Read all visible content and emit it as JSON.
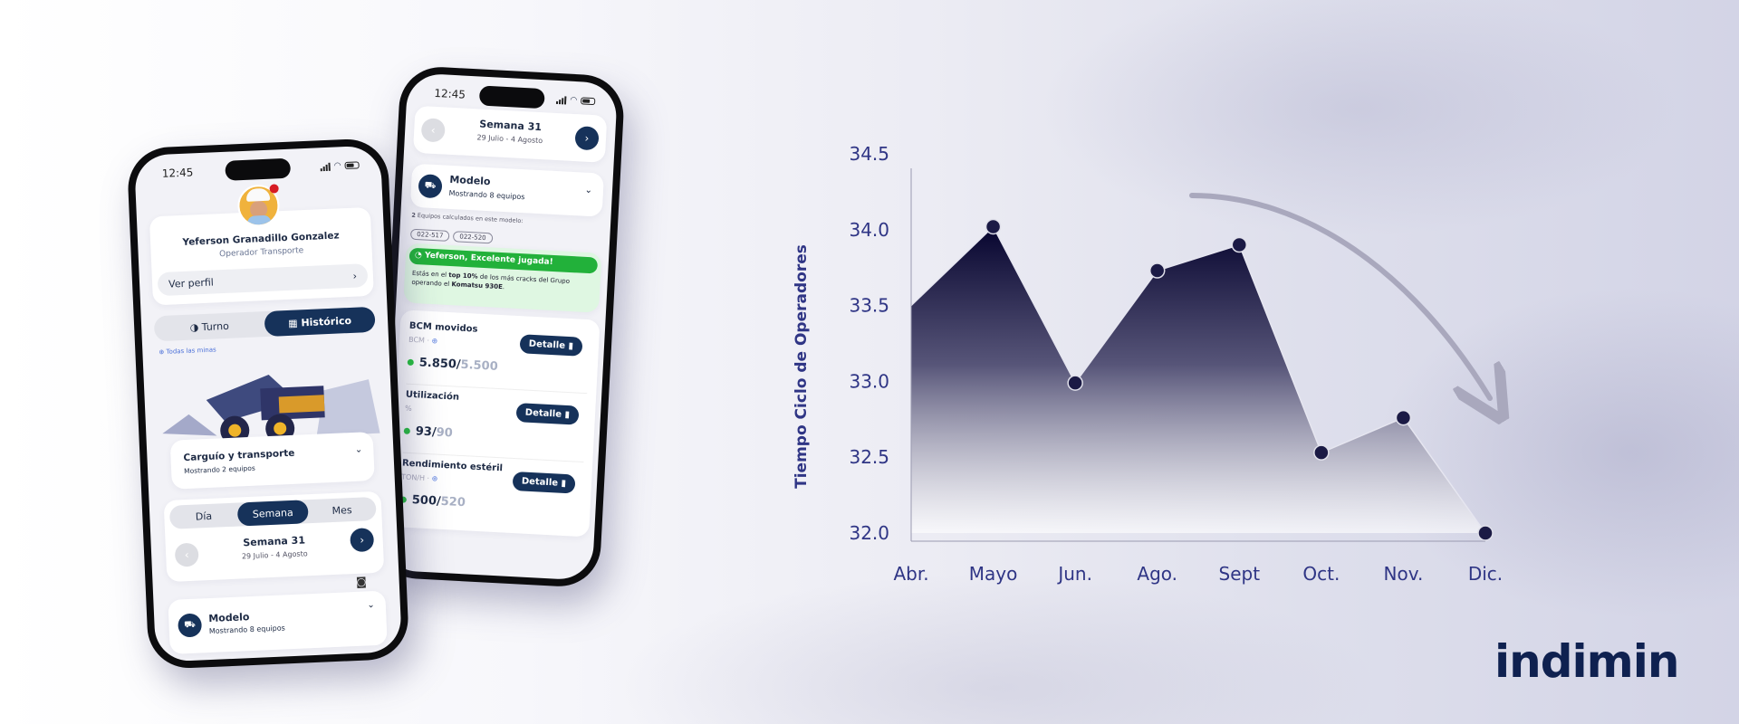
{
  "brand": {
    "logo_text": "indimin",
    "logo_color": "#0f2150"
  },
  "left_phone": {
    "time": "12:45",
    "profile": {
      "name": "Yeferson Granadillo Gonzalez",
      "role": "Operador Transporte",
      "view_profile": "Ver perfil"
    },
    "toggle": {
      "turno": "Turno",
      "historico": "Histórico",
      "active": "Histórico"
    },
    "scope": "Todas las minas",
    "process": {
      "title": "Carguío y transporte",
      "subtitle": "Mostrando 2 equipos"
    },
    "period_tabs": [
      "Día",
      "Semana",
      "Mes"
    ],
    "period_active": "Semana",
    "week": {
      "title": "Semana 31",
      "range": "29 Julio - 4 Agosto"
    },
    "model": {
      "title": "Modelo",
      "subtitle": "Mostrando 8 equipos"
    }
  },
  "right_phone": {
    "time": "12:45",
    "week": {
      "title": "Semana 31",
      "range": "29 Julio - 4 Agosto"
    },
    "model": {
      "title": "Modelo",
      "subtitle": "Mostrando 8 equipos",
      "count_bold": "2",
      "count_text": " Equipos calculados en este modelo:",
      "chips": [
        "022-517",
        "022-520"
      ]
    },
    "banner": {
      "title": "Yeferson, Excelente jugada!",
      "t1": "Estás en el ",
      "b1": "top 10%",
      "t2": " de los más cracks del Grupo operando el ",
      "b2": "Komatsu 930E",
      "t3": "."
    },
    "metrics": [
      {
        "title": "BCM movidos",
        "unit": "BCM",
        "value": "5.850",
        "target": "5.500",
        "button": "Detalle",
        "status_color": "#25c23c"
      },
      {
        "title": "Utilización",
        "unit": "%",
        "value": "93",
        "target": "90",
        "button": "Detalle",
        "status_color": "#25c23c"
      },
      {
        "title": "Rendimiento estéril",
        "unit": "TON/H",
        "value": "500",
        "target": "520",
        "button": "Detalle",
        "status_color": "#25c23c"
      }
    ]
  },
  "chart_data": {
    "type": "area",
    "categories": [
      "Abr.",
      "Mayo",
      "Jun.",
      "Ago.",
      "Sept",
      "Oct.",
      "Nov.",
      "Dic."
    ],
    "values": [
      33.5,
      34.02,
      32.99,
      33.73,
      33.9,
      32.53,
      32.76,
      32.0
    ],
    "ylabel": "Tiempo Ciclo de Operadores",
    "xlabel": "",
    "yticks": [
      "32.0",
      "32.5",
      "33.0",
      "33.5",
      "34.0",
      "34.5"
    ],
    "ylim": [
      32.0,
      34.5
    ],
    "grid": false,
    "annotation": "downward-trend-arrow",
    "colors": {
      "fill_top": "#06042e",
      "fill_bottom": "#ffffff",
      "axis_text": "#2f3585",
      "dots": "#1b1a45",
      "arrow": "#a9a8bd"
    }
  }
}
